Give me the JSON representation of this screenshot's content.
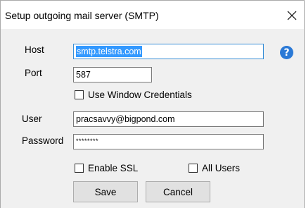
{
  "window": {
    "title": "Setup outgoing mail server (SMTP)",
    "close_glyph": "✕"
  },
  "form": {
    "host": {
      "label": "Host",
      "value": "smtp.telstra.com"
    },
    "port": {
      "label": "Port",
      "value": "587"
    },
    "use_window_credentials": {
      "label": "Use Window Credentials",
      "checked": false
    },
    "user": {
      "label": "User",
      "value": "pracsavvy@bigpond.com"
    },
    "password": {
      "label": "Password",
      "value": "********"
    },
    "enable_ssl": {
      "label": "Enable SSL",
      "checked": false
    },
    "all_users": {
      "label": "All Users",
      "checked": false
    }
  },
  "help": {
    "glyph": "?",
    "icon": "help-icon"
  },
  "buttons": {
    "save": "Save",
    "cancel": "Cancel"
  },
  "colors": {
    "accent": "#3399ff",
    "help_icon": "#2a79d6"
  }
}
